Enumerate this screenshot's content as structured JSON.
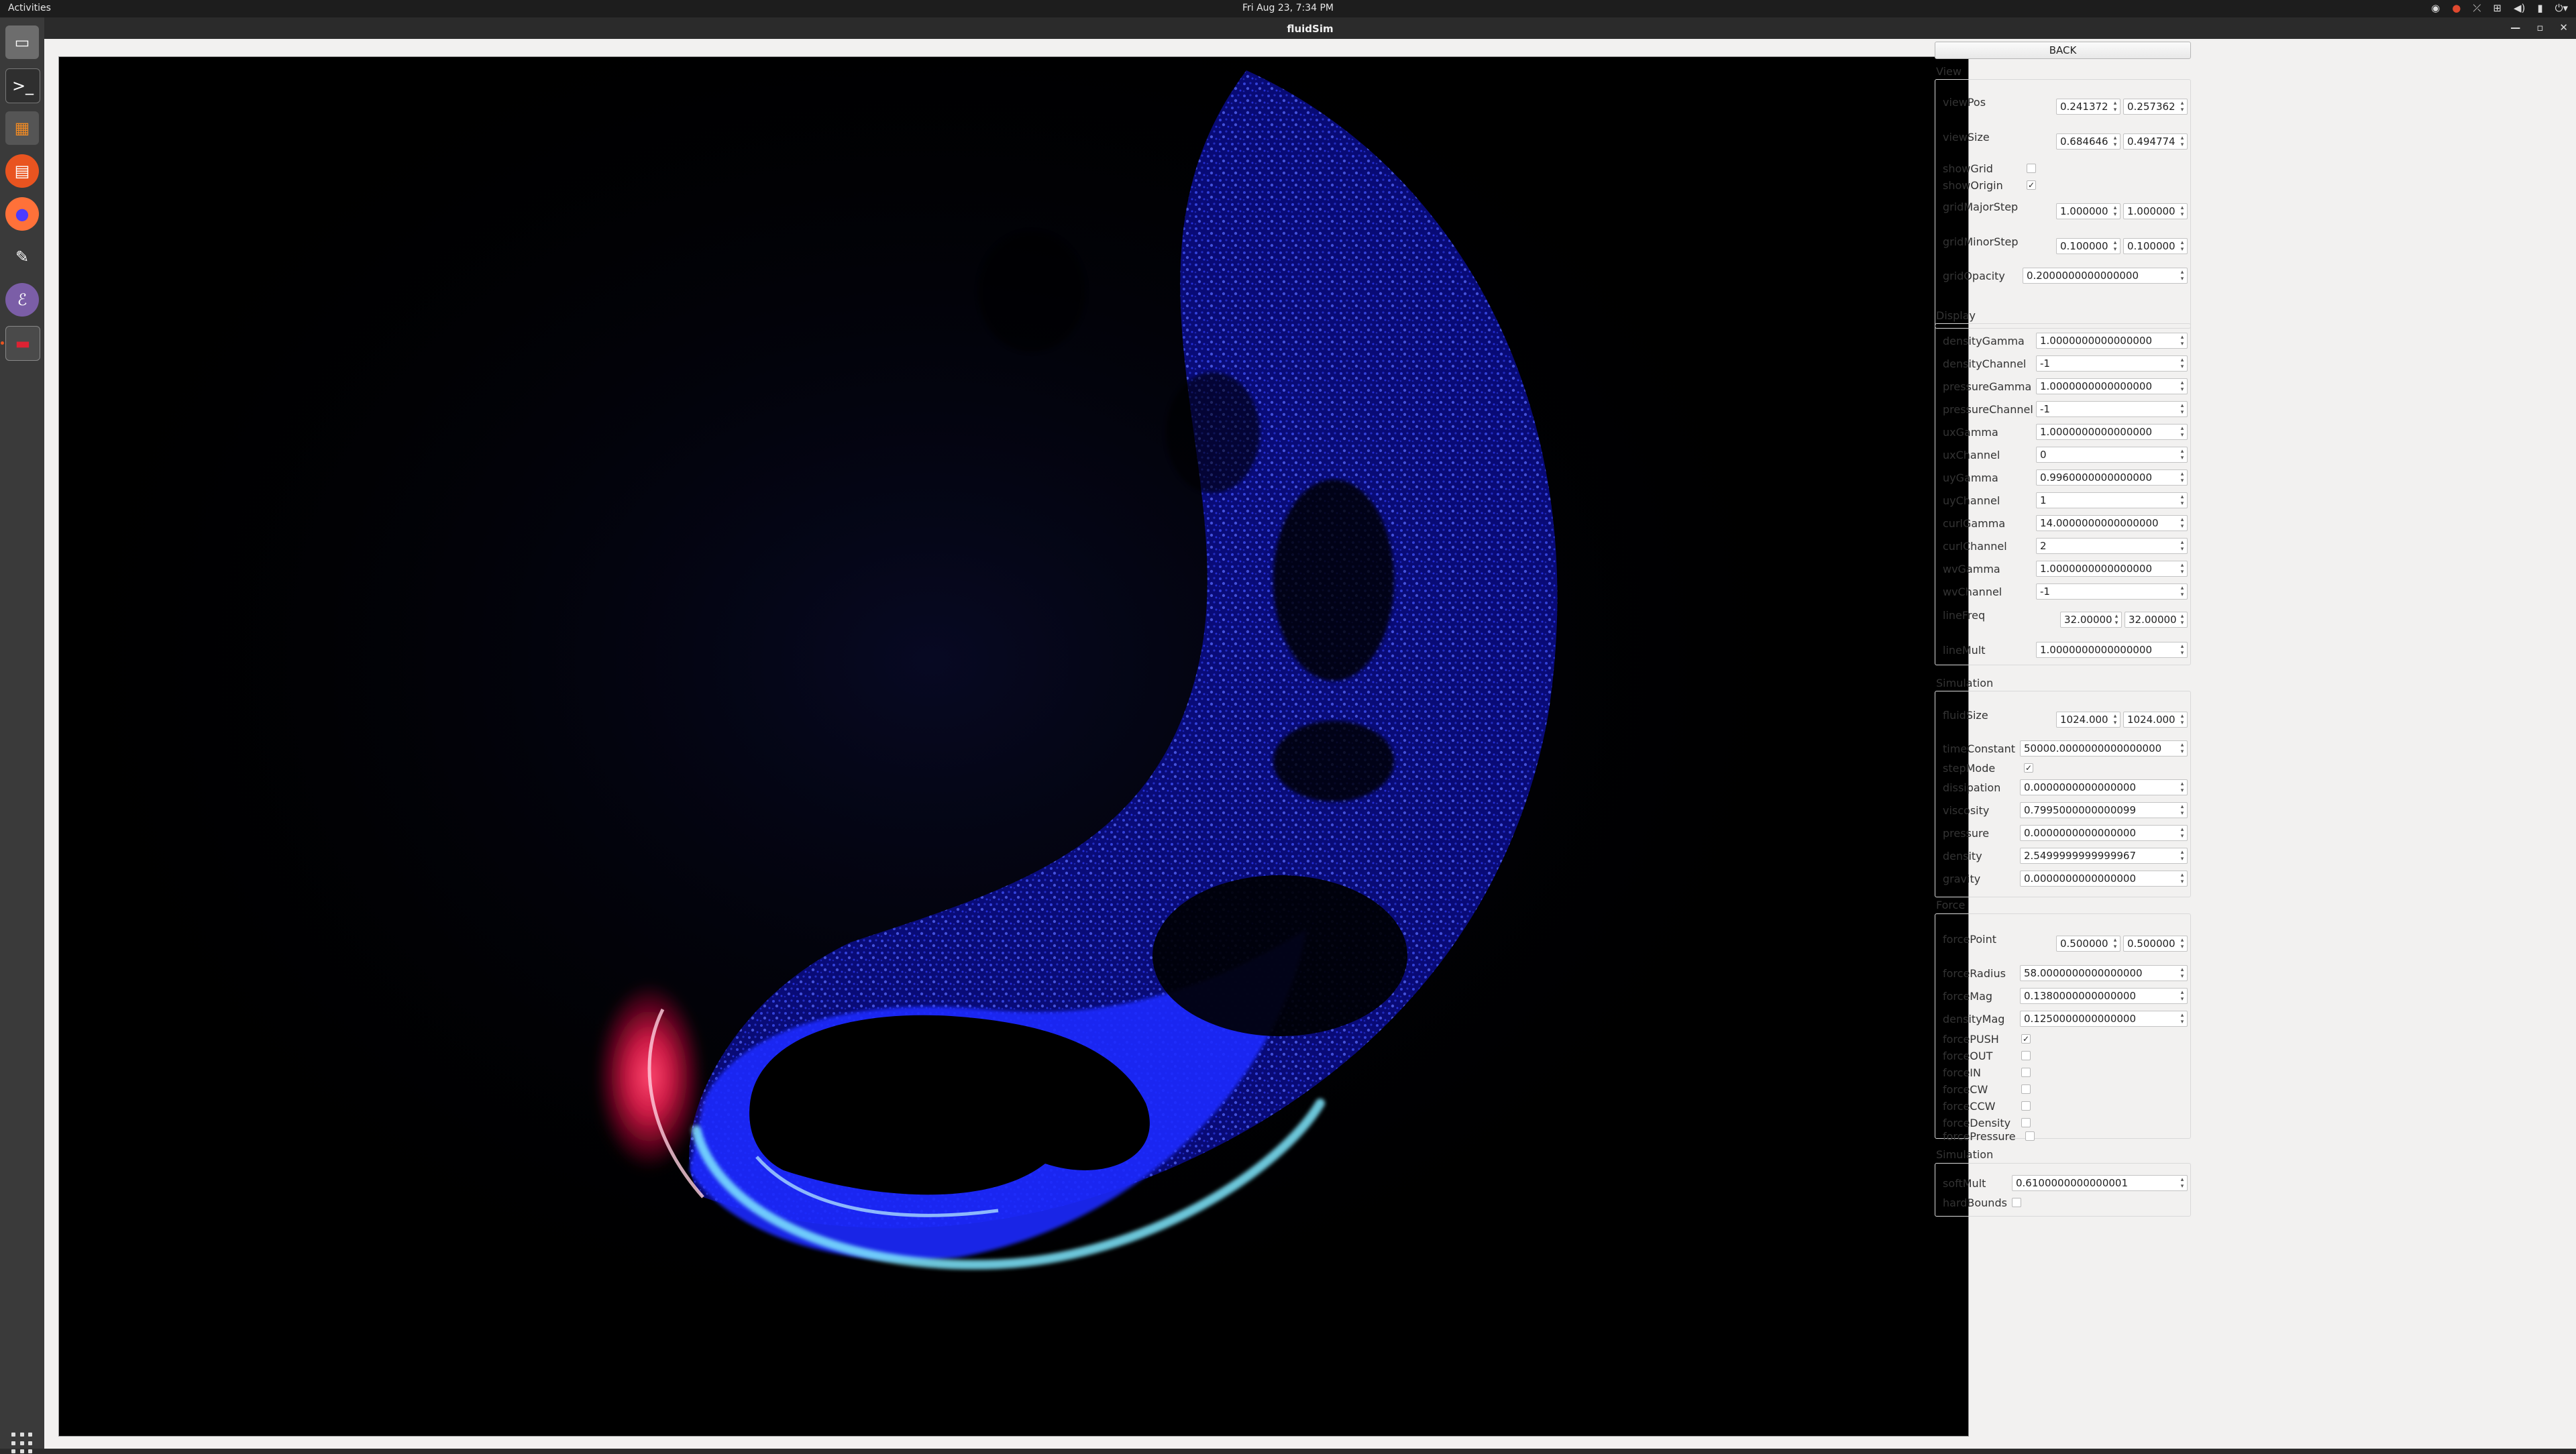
{
  "topbar": {
    "activities": "Activities",
    "clock": "Fri Aug 23,  7:34 PM"
  },
  "tray_icons": [
    "steam-icon",
    "update-icon",
    "network-off-icon",
    "network-icon",
    "volume-icon",
    "battery-icon",
    "power-icon"
  ],
  "dock": {
    "items": [
      "files-icon",
      "terminal-icon",
      "calculator-icon",
      "software-center-icon",
      "firefox-icon",
      "gimp-icon",
      "emacs-icon",
      "fluidsim-window-icon"
    ],
    "apps_icon": "show-applications-icon"
  },
  "window": {
    "title": "fluidSim"
  },
  "panel": {
    "back_label": "BACK",
    "sections": {
      "view": "View",
      "display": "Display",
      "simulation": "Simulation",
      "force": "Force",
      "simulation2": "Simulation"
    },
    "view": {
      "viewPos": {
        "label": "viewPos",
        "x": "0.241372",
        "y": "0.257362"
      },
      "viewSize": {
        "label": "viewSize",
        "x": "0.684646",
        "y": "0.494774"
      },
      "showGrid": {
        "label": "showGrid",
        "checked": false
      },
      "showOrigin": {
        "label": "showOrigin",
        "checked": true
      },
      "gridMajorStep": {
        "label": "gridMajorStep",
        "x": "1.000000",
        "y": "1.000000"
      },
      "gridMinorStep": {
        "label": "gridMinorStep",
        "x": "0.100000",
        "y": "0.100000"
      },
      "gridOpacity": {
        "label": "gridOpacity",
        "value": "0.2000000000000000"
      }
    },
    "display": {
      "densityGamma": {
        "label": "densityGamma",
        "value": "1.0000000000000000"
      },
      "densityChannel": {
        "label": "densityChannel",
        "value": "-1"
      },
      "pressureGamma": {
        "label": "pressureGamma",
        "value": "1.0000000000000000"
      },
      "pressureChannel": {
        "label": "pressureChannel",
        "value": "-1"
      },
      "uxGamma": {
        "label": "uxGamma",
        "value": "1.0000000000000000"
      },
      "uxChannel": {
        "label": "uxChannel",
        "value": "0"
      },
      "uyGamma": {
        "label": "uyGamma",
        "value": "0.9960000000000000"
      },
      "uyChannel": {
        "label": "uyChannel",
        "value": "1"
      },
      "curlGamma": {
        "label": "curlGamma",
        "value": "14.0000000000000000"
      },
      "curlChannel": {
        "label": "curlChannel",
        "value": "2"
      },
      "wvGamma": {
        "label": "wvGamma",
        "value": "1.0000000000000000"
      },
      "wvChannel": {
        "label": "wvChannel",
        "value": "-1"
      },
      "lineFreq": {
        "label": "lineFreq",
        "x": "32.00000",
        "y": "32.00000"
      },
      "lineMult": {
        "label": "lineMult",
        "value": "1.0000000000000000"
      }
    },
    "simulation": {
      "fluidSize": {
        "label": "fluidSize",
        "x": "1024.000",
        "y": "1024.000"
      },
      "timeConstant": {
        "label": "timeConstant",
        "value": "50000.0000000000000000"
      },
      "stepMode": {
        "label": "stepMode",
        "checked": true
      },
      "dissipation": {
        "label": "dissipation",
        "value": "0.0000000000000000"
      },
      "viscosity": {
        "label": "viscosity",
        "value": "0.7995000000000099"
      },
      "pressure": {
        "label": "pressure",
        "value": "0.0000000000000000"
      },
      "density": {
        "label": "density",
        "value": "2.5499999999999967"
      },
      "gravity": {
        "label": "gravity",
        "value": "0.0000000000000000"
      }
    },
    "force": {
      "forcePoint": {
        "label": "forcePoint",
        "x": "0.500000",
        "y": "0.500000"
      },
      "forceRadius": {
        "label": "forceRadius",
        "value": "58.0000000000000000"
      },
      "forceMag": {
        "label": "forceMag",
        "value": "0.1380000000000000"
      },
      "densityMag": {
        "label": "densityMag",
        "value": "0.1250000000000000"
      },
      "forcePUSH": {
        "label": "forcePUSH",
        "checked": true
      },
      "forceOUT": {
        "label": "forceOUT",
        "checked": false
      },
      "forceIN": {
        "label": "forceIN",
        "checked": false
      },
      "forceCW": {
        "label": "forceCW",
        "checked": false
      },
      "forceCCW": {
        "label": "forceCCW",
        "checked": false
      },
      "forceDensity": {
        "label": "forceDensity",
        "checked": false
      },
      "forcePressure": {
        "label": "forcePressure",
        "checked": false
      }
    },
    "simulation2": {
      "softMult": {
        "label": "softMult",
        "value": "0.6100000000000001"
      },
      "hardBounds": {
        "label": "hardBounds",
        "checked": false
      }
    }
  },
  "colors": {
    "background": "#000000",
    "fluid_blue": "#2a3cff",
    "fluid_cyan": "#7fe8ff",
    "fluid_red": "#ff2050",
    "panel_bg": "#f2f1f0"
  }
}
